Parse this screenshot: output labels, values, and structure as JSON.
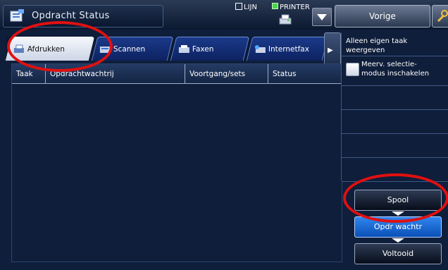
{
  "header": {
    "title": "Opdracht Status",
    "status_line": "LIJN",
    "status_printer": "PRINTER",
    "back_button": "Vorige",
    "title_icon": "job-status-icon",
    "printer_icon": "printer-icon",
    "dropdown_icon": "dropdown-arrow-icon",
    "settings_icon": "wrench-settings-icon"
  },
  "tabs": [
    {
      "label": "Afdrukken",
      "icon": "print-tab-icon",
      "active": true
    },
    {
      "label": "Scannen",
      "icon": "scan-tab-icon",
      "active": false
    },
    {
      "label": "Faxen",
      "icon": "fax-tab-icon",
      "active": false
    },
    {
      "label": "Internetfax",
      "icon": "internetfax-tab-icon",
      "active": false
    }
  ],
  "table": {
    "columns": [
      "Taak",
      "Opdrachtwachtrij",
      "Voortgang/sets",
      "Status"
    ]
  },
  "side_panel": {
    "own_jobs_label": "Alleen eigen taak\nweergeven",
    "multi_select_label": "Meerv. selectie-\nmodus inschakelen"
  },
  "actions": {
    "spool": "Spool",
    "queue": "Opdr wachtr",
    "completed": "Voltooid"
  },
  "colors": {
    "background": "#0f1e3a",
    "active_button": "#1f6fe0",
    "highlight_ring": "#e01010",
    "status_green": "#4cd34c"
  }
}
